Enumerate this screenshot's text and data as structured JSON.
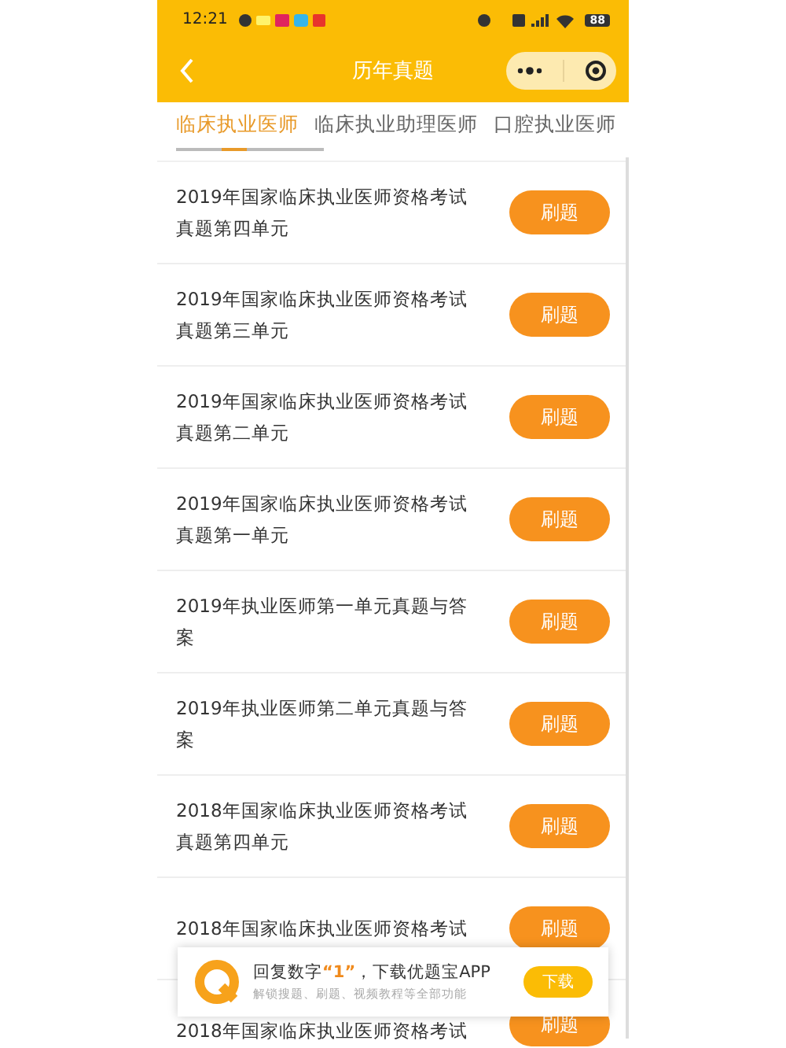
{
  "status_bar": {
    "time": "12:21",
    "battery": "88"
  },
  "nav": {
    "title": "历年真题"
  },
  "tabs": [
    {
      "label": "临床执业医师",
      "selected": true
    },
    {
      "label": "临床执业助理医师",
      "selected": false
    },
    {
      "label": "口腔执业医师",
      "selected": false
    }
  ],
  "items": [
    {
      "title": "2019年国家临床执业医师资格考试真题第四单元",
      "button": "刷题"
    },
    {
      "title": "2019年国家临床执业医师资格考试真题第三单元",
      "button": "刷题"
    },
    {
      "title": "2019年国家临床执业医师资格考试真题第二单元",
      "button": "刷题"
    },
    {
      "title": "2019年国家临床执业医师资格考试真题第一单元",
      "button": "刷题"
    },
    {
      "title": "2019年执业医师第一单元真题与答案",
      "button": "刷题"
    },
    {
      "title": "2019年执业医师第二单元真题与答案",
      "button": "刷题"
    },
    {
      "title": "2018年国家临床执业医师资格考试真题第四单元",
      "button": "刷题"
    },
    {
      "title": "2018年国家临床执业医师资格考试",
      "button": "刷题"
    },
    {
      "title": "2018年国家临床执业医师资格考试",
      "button": "刷题"
    }
  ],
  "banner": {
    "text_before": "回复数字",
    "highlight": "“1”",
    "text_after": "，下载优题宝APP",
    "subtitle": "解锁搜题、刷题、视频教程等全部功能",
    "button": "下载"
  }
}
